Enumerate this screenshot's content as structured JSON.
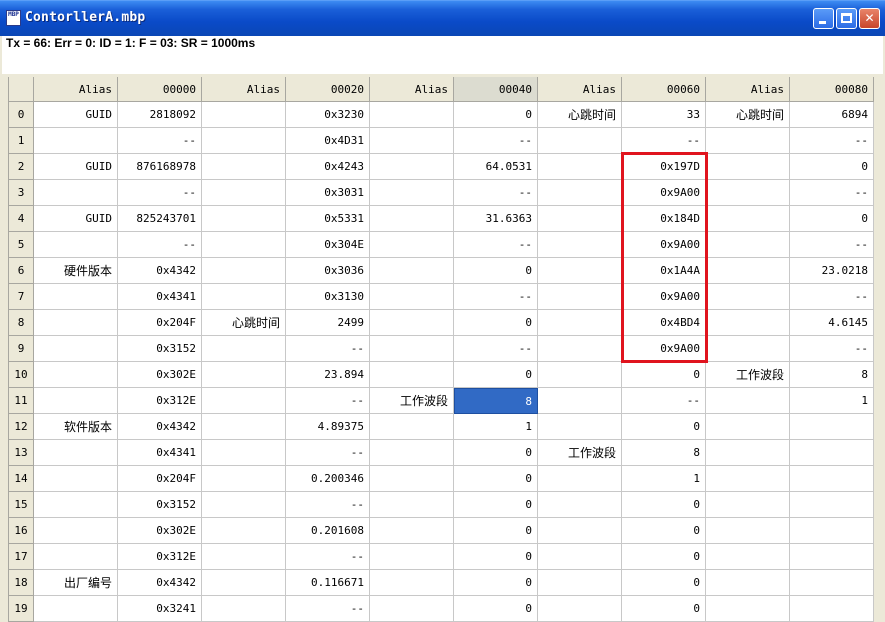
{
  "window": {
    "title": "ContorllerA.mbp",
    "icon_label": "MBP",
    "buttons": [
      "minimize",
      "maximize",
      "close"
    ]
  },
  "status_line": "Tx = 66: Err = 0: ID = 1: F = 03: SR = 1000ms",
  "colors": {
    "title_bar": "#0a4ac8",
    "selected_cell": "#316ac5",
    "highlight_border": "#e0141e",
    "header_bg": "#ece9d8"
  },
  "columns": [
    "Alias",
    "00000",
    "Alias",
    "00020",
    "Alias",
    "00040",
    "Alias",
    "00060",
    "Alias",
    "00080"
  ],
  "selected_column": 5,
  "selected_row": 11,
  "highlighted_range": {
    "column": "00060",
    "rows": [
      2,
      9
    ]
  },
  "rows": [
    [
      "GUID",
      "2818092",
      "",
      "0x3230",
      "",
      "0",
      "心跳时间",
      "33",
      "心跳时间",
      "6894"
    ],
    [
      "",
      "--",
      "",
      "0x4D31",
      "",
      "--",
      "",
      "--",
      "",
      "--"
    ],
    [
      "GUID",
      "876168978",
      "",
      "0x4243",
      "",
      "64.0531",
      "",
      "0x197D",
      "",
      "0"
    ],
    [
      "",
      "--",
      "",
      "0x3031",
      "",
      "--",
      "",
      "0x9A00",
      "",
      "--"
    ],
    [
      "GUID",
      "825243701",
      "",
      "0x5331",
      "",
      "31.6363",
      "",
      "0x184D",
      "",
      "0"
    ],
    [
      "",
      "--",
      "",
      "0x304E",
      "",
      "--",
      "",
      "0x9A00",
      "",
      "--"
    ],
    [
      "硬件版本",
      "0x4342",
      "",
      "0x3036",
      "",
      "0",
      "",
      "0x1A4A",
      "",
      "23.0218"
    ],
    [
      "",
      "0x4341",
      "",
      "0x3130",
      "",
      "--",
      "",
      "0x9A00",
      "",
      "--"
    ],
    [
      "",
      "0x204F",
      "心跳时间",
      "2499",
      "",
      "0",
      "",
      "0x4BD4",
      "",
      "4.6145"
    ],
    [
      "",
      "0x3152",
      "",
      "--",
      "",
      "--",
      "",
      "0x9A00",
      "",
      "--"
    ],
    [
      "",
      "0x302E",
      "",
      "23.894",
      "",
      "0",
      "",
      "0",
      "工作波段",
      "8"
    ],
    [
      "",
      "0x312E",
      "",
      "--",
      "工作波段",
      "8",
      "",
      "--",
      "",
      "1"
    ],
    [
      "软件版本",
      "0x4342",
      "",
      "4.89375",
      "",
      "1",
      "",
      "0",
      "",
      ""
    ],
    [
      "",
      "0x4341",
      "",
      "--",
      "",
      "0",
      "工作波段",
      "8",
      "",
      ""
    ],
    [
      "",
      "0x204F",
      "",
      "0.200346",
      "",
      "0",
      "",
      "1",
      "",
      ""
    ],
    [
      "",
      "0x3152",
      "",
      "--",
      "",
      "0",
      "",
      "0",
      "",
      ""
    ],
    [
      "",
      "0x302E",
      "",
      "0.201608",
      "",
      "0",
      "",
      "0",
      "",
      ""
    ],
    [
      "",
      "0x312E",
      "",
      "--",
      "",
      "0",
      "",
      "0",
      "",
      ""
    ],
    [
      "出厂编号",
      "0x4342",
      "",
      "0.116671",
      "",
      "0",
      "",
      "0",
      "",
      ""
    ],
    [
      "",
      "0x3241",
      "",
      "--",
      "",
      "0",
      "",
      "0",
      "",
      ""
    ]
  ]
}
